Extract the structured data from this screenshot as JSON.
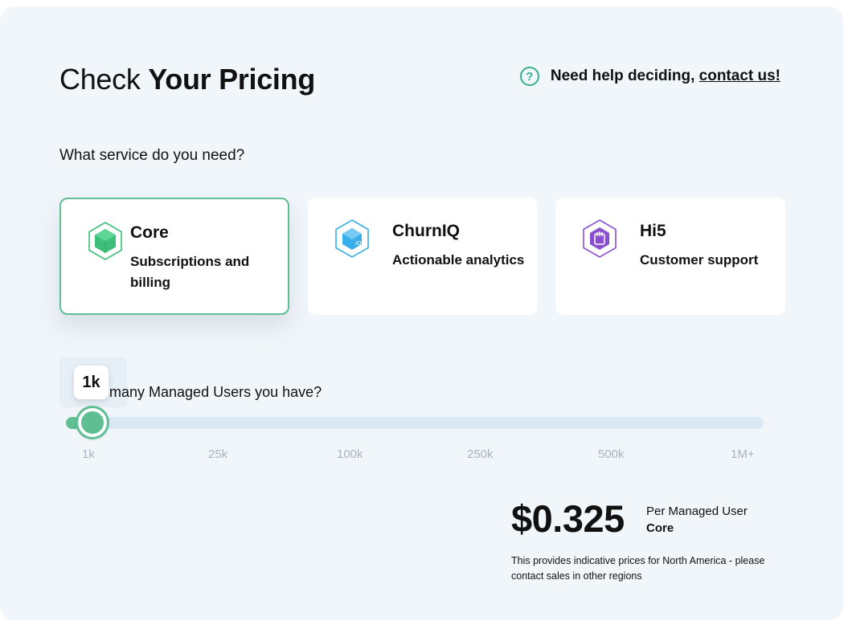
{
  "header": {
    "title_prefix": "Check",
    "title_bold": "Your Pricing",
    "help_icon": "question-circle-icon",
    "help_text": "Need help deciding,",
    "help_link": "contact us!"
  },
  "service": {
    "question": "What service do you need?",
    "selected": "Core",
    "options": [
      {
        "name": "Core",
        "description": "Subscriptions and billing",
        "icon": "core-hexagon-icon",
        "color": "#3dbf7a"
      },
      {
        "name": "ChurnIQ",
        "description": "Actionable analytics",
        "icon": "churniq-hexagon-icon",
        "color": "#3aaee8"
      },
      {
        "name": "Hi5",
        "description": "Customer support",
        "icon": "hi5-hexagon-icon",
        "color": "#8a4fd1"
      }
    ]
  },
  "users": {
    "question_visible": "many Managed Users you have?",
    "current_value_label": "1k",
    "slider_position": 0,
    "ticks": [
      "1k",
      "25k",
      "100k",
      "250k",
      "500k",
      "1M+"
    ]
  },
  "result": {
    "price": "$0.325",
    "per_label": "Per Managed User",
    "plan": "Core",
    "note": "This provides indicative prices for North America - please contact sales in other regions"
  },
  "colors": {
    "accent": "#5fbf93",
    "panel_bg": "#f1f6fb",
    "track": "#dbe8f6"
  }
}
